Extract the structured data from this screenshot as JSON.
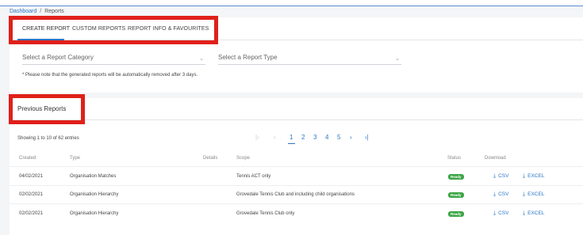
{
  "breadcrumb": {
    "home": "Dashboard",
    "separator": "/",
    "current": "Reports"
  },
  "tabs": [
    {
      "label": "CREATE REPORT",
      "active": true
    },
    {
      "label": "CUSTOM REPORTS",
      "active": false
    },
    {
      "label": "REPORT INFO & FAVOURITES",
      "active": false
    }
  ],
  "filters": {
    "category_placeholder": "Select a Report Category",
    "type_placeholder": "Select a Report Type",
    "note": "* Please note that the generated reports will be automatically removed after 3 days."
  },
  "previous": {
    "title": "Previous Reports",
    "showing": "Showing 1 to 10 of 62 entries",
    "pagination": {
      "first": "|‹",
      "prev": "‹",
      "pages": [
        "1",
        "2",
        "3",
        "4",
        "5"
      ],
      "current": "1",
      "next": "›",
      "last": "›|"
    },
    "columns": [
      "Created",
      "Type",
      "Details",
      "Scope",
      "Status",
      "Download"
    ],
    "rows": [
      {
        "created": "04/02/2021",
        "type": "Organisation Matches",
        "details": "",
        "scope": "Tennis ACT only",
        "status": "Ready",
        "csv": "CSV",
        "excel": "EXCEL"
      },
      {
        "created": "02/02/2021",
        "type": "Organisation Hierarchy",
        "details": "",
        "scope": "Grovedale Tennis Club and including child organisations",
        "status": "Ready",
        "csv": "CSV",
        "excel": "EXCEL"
      },
      {
        "created": "02/02/2021",
        "type": "Organisation Hierarchy",
        "details": "",
        "scope": "Grovedale Tennis Club only",
        "status": "Ready",
        "csv": "CSV",
        "excel": "EXCEL"
      }
    ]
  },
  "colors": {
    "accent": "#2b78c5",
    "highlight": "#e0201a",
    "ready": "#3aa544"
  },
  "icons": {
    "caret": "chevron-down-icon",
    "download": "download-icon"
  }
}
